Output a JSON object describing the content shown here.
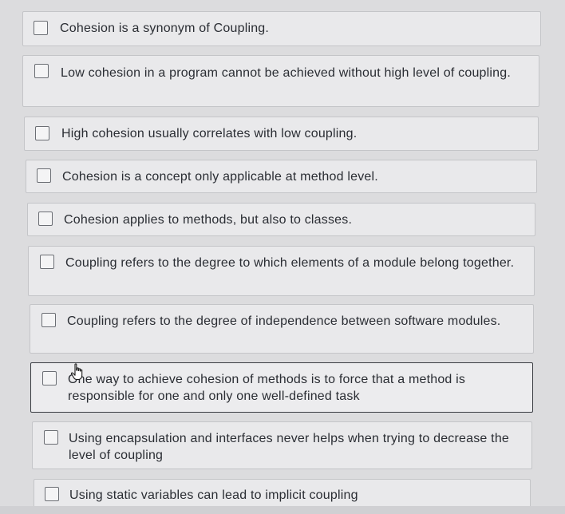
{
  "options": [
    {
      "label": "Cohesion is a synonym of Coupling.",
      "checked": false
    },
    {
      "label": "Low cohesion in a program cannot be achieved without high level of coupling.",
      "checked": false
    },
    {
      "label": "High cohesion usually correlates with low coupling.",
      "checked": false
    },
    {
      "label": "Cohesion is a concept only applicable at method level.",
      "checked": false
    },
    {
      "label": "Cohesion applies to methods, but also to classes.",
      "checked": false
    },
    {
      "label": "Coupling refers to the degree to which elements of a module belong together.",
      "checked": false
    },
    {
      "label": "Coupling refers to the degree of independence between software modules.",
      "checked": false
    },
    {
      "label": "One way to achieve cohesion of methods is to force that a method is responsible for one and only one well-defined task",
      "checked": false
    },
    {
      "label": "Using encapsulation and interfaces never helps when trying to decrease the level of coupling",
      "checked": false
    },
    {
      "label": "Using static variables can lead to implicit coupling",
      "checked": false
    }
  ],
  "cursor_icon": "hand-pointer-icon"
}
